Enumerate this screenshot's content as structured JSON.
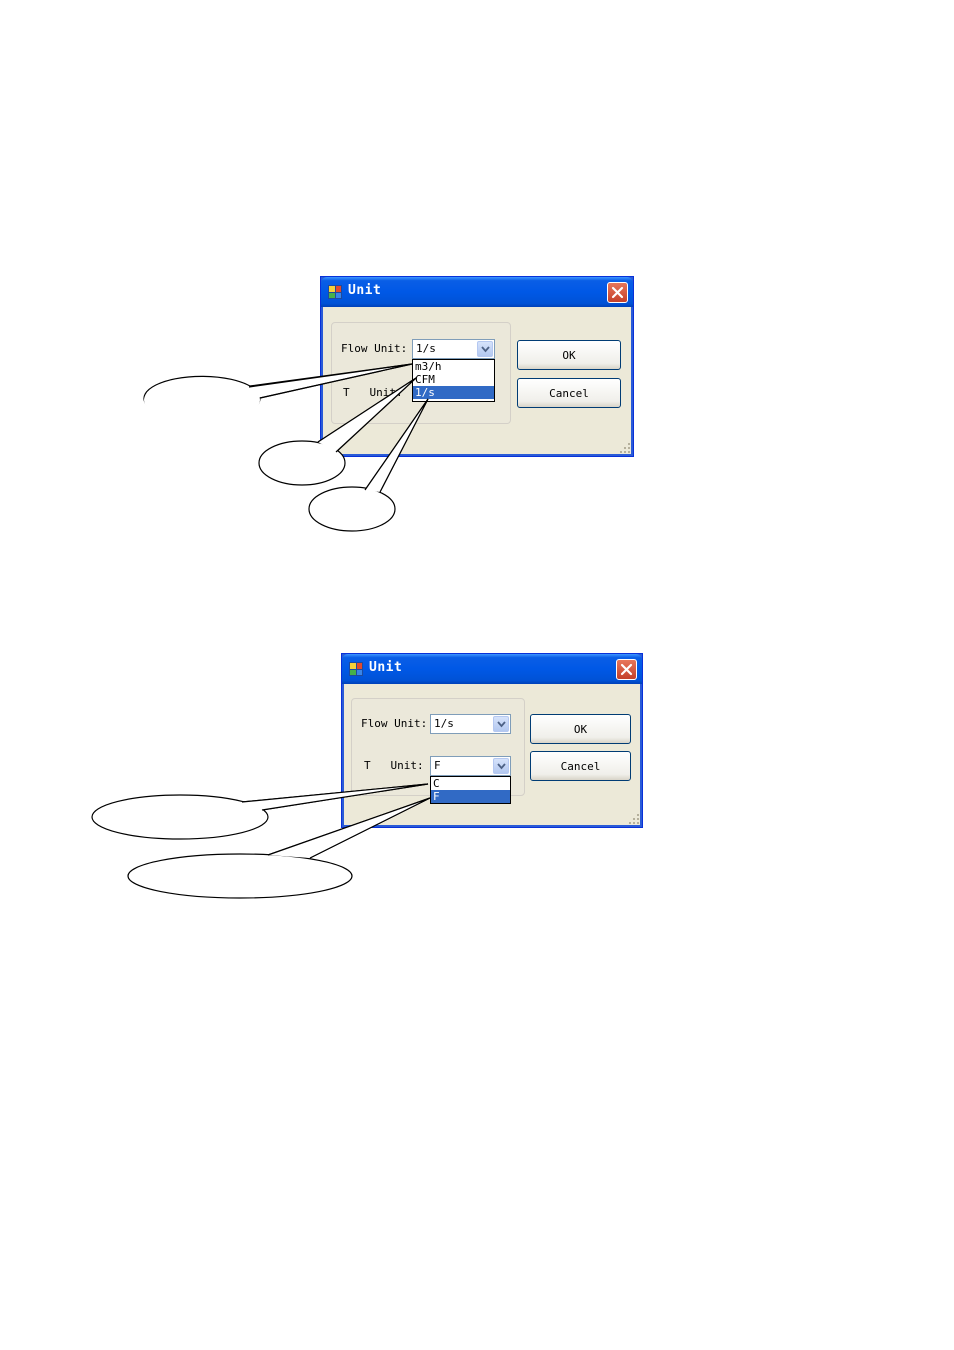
{
  "dialog1": {
    "title": "Unit",
    "flow_label": "Flow Unit:",
    "flow_value": "1/s",
    "flow_options": [
      "m3/h",
      "CFM",
      "1/s"
    ],
    "flow_selected": "1/s",
    "t_label": "T   Unit:",
    "ok_label": "OK",
    "cancel_label": "Cancel"
  },
  "dialog2": {
    "title": "Unit",
    "flow_label": "Flow Unit:",
    "flow_value": "1/s",
    "t_label": "T   Unit:",
    "t_value": "F",
    "t_options": [
      "C",
      "F"
    ],
    "t_selected": "F",
    "ok_label": "OK",
    "cancel_label": "Cancel"
  },
  "icons": {
    "app": "app-icon",
    "close": "close-icon",
    "dropdown": "chevron-down-icon",
    "grip": "resize-grip-icon"
  },
  "colors": {
    "titlebar": "#0058e6",
    "dialog_bg": "#ece9d8",
    "selection": "#316ac5",
    "close_button": "#c4402a"
  }
}
